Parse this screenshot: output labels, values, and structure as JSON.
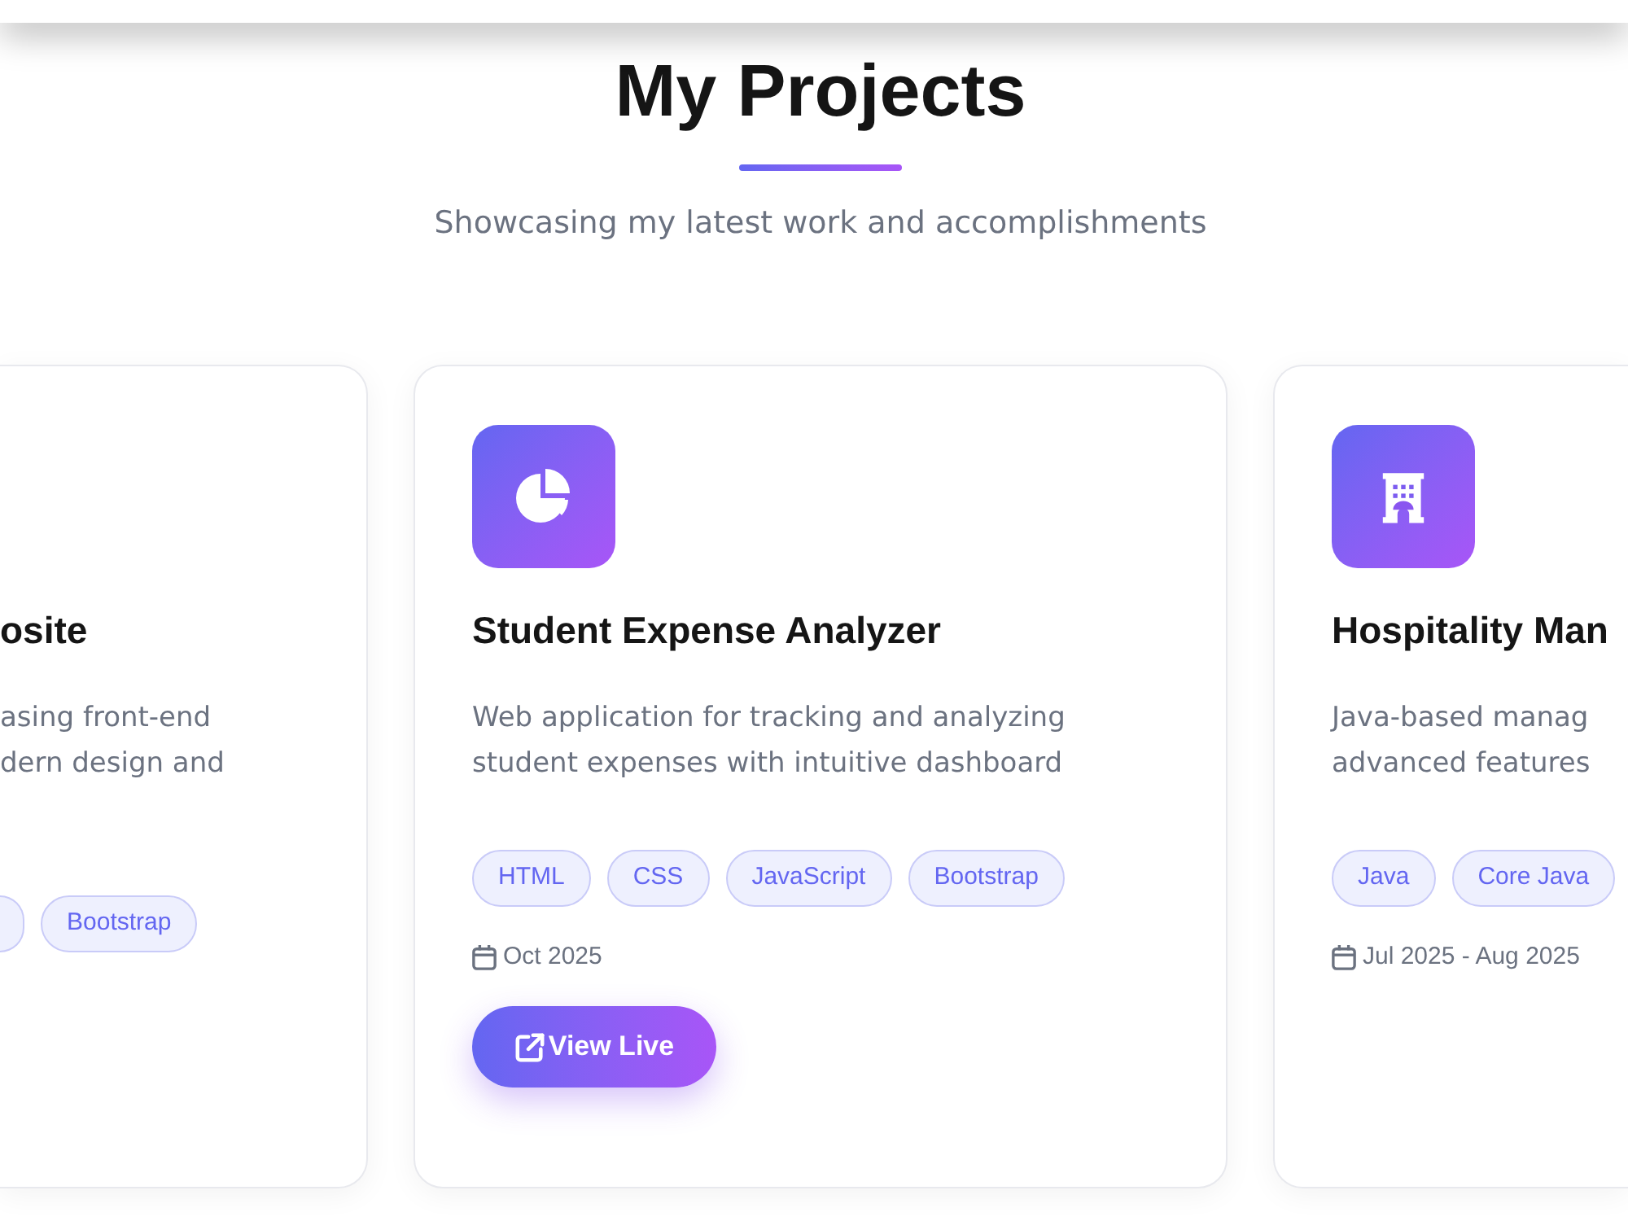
{
  "section": {
    "title": "My Projects",
    "subtitle": "Showcasing my latest work and accomplishments"
  },
  "projects": [
    {
      "clipped_left": true,
      "clipped_right": false,
      "title": "osite",
      "description_lines": [
        "asing front-end",
        "dern design and"
      ],
      "tags": [
        "Bootstrap"
      ]
    },
    {
      "clipped_left": false,
      "clipped_right": false,
      "title": "Student Expense Analyzer",
      "description_lines": [
        "Web application for tracking and analyzing",
        "student expenses with intuitive dashboard"
      ],
      "tags": [
        "HTML",
        "CSS",
        "JavaScript",
        "Bootstrap"
      ],
      "date": "Oct 2025",
      "link": "View Live"
    },
    {
      "clipped_left": false,
      "clipped_right": true,
      "title": "Hospitality Man",
      "description_lines": [
        "Java-based manag",
        "advanced features"
      ],
      "tags": [
        "Java",
        "Core Java"
      ],
      "date": "Jul 2025 - Aug 2025"
    }
  ]
}
